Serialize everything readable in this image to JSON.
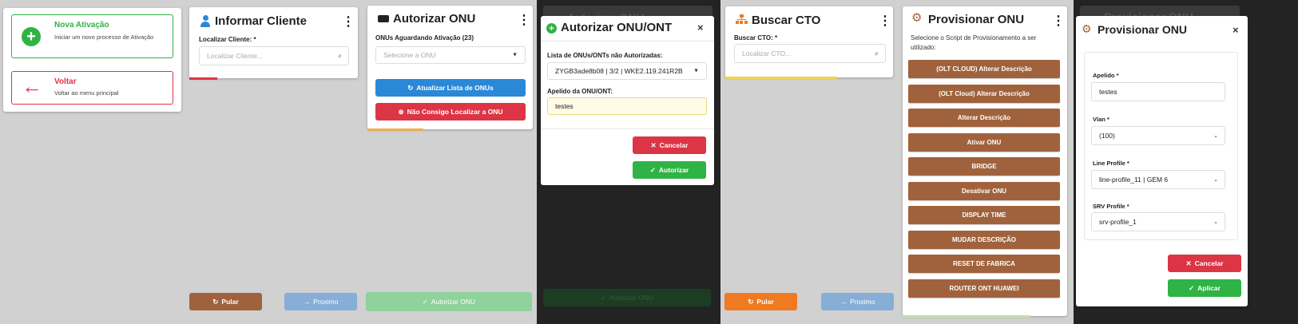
{
  "colors": {
    "green": "#2fb344",
    "red": "#dc3545",
    "brown": "#a0623c",
    "blue": "#2b88d8",
    "orange": "#ef7a22"
  },
  "panel1": {
    "nova_title": "Nova Ativação",
    "nova_desc": "Iniciar um novo processo de Ativação",
    "voltar_title": "Voltar",
    "voltar_desc": "Voltar ao menu principal"
  },
  "panel2": {
    "title": "Informar Cliente",
    "label": "Localizar Cliente: *",
    "placeholder": "Localizar Cliente...",
    "pular": "Pular",
    "proximo": "Proximo"
  },
  "panel3": {
    "title": "Autorizar ONU",
    "label": "ONUs Aguardando Ativação (23)",
    "select_placeholder": "Selecione a ONU",
    "atualizar": "Atualizar Lista de ONUs",
    "nao_consigo": "Não Consigo Localizar a ONU",
    "autorizar_bottom": "Autorizar ONU"
  },
  "panel4": {
    "bg_title": "Autorizar ONU",
    "modal_title": "Autorizar ONU/ONT",
    "list_label": "Lista de ONUs/ONTs não Autorizadas:",
    "list_value": "ZYGB3ade8b08 | 3/2 | WKE2.119.241R2B",
    "apelido_label": "Apelido da ONU/ONT:",
    "apelido_value": "testes",
    "cancelar": "Cancelar",
    "autorizar": "Autorizar",
    "autorizar_bottom": "Autorizar ONU"
  },
  "panel5": {
    "title": "Buscar CTO",
    "label": "Buscar CTO: *",
    "placeholder": "Localizar CTO...",
    "pular": "Pular",
    "proximo": "Proximo"
  },
  "panel6": {
    "title": "Provisionar ONU",
    "desc": "Selecione o Script de Provisionamento a ser utilizado:",
    "scripts": [
      "(OLT CLOUD) Alterar Descrição",
      "(OLT Cloud) Alterar Descrição",
      "Alterar Descrição",
      "Ativar ONU",
      "BRIDGE",
      "Desativar ONU",
      "DISPLAY TIME",
      "MUDAR DESCRIÇÃO",
      "RESET DE FABRICA",
      "ROUTER ONT HUAWEI"
    ]
  },
  "panel7": {
    "bg_title": "Provisionar ONU",
    "modal_title": "Provisionar ONU",
    "apelido_label": "Apelido *",
    "apelido_value": "testes",
    "vlan_label": "Vlan *",
    "vlan_value": "(100)",
    "line_label": "Line Profile *",
    "line_value": "line-profile_11 | GEM 6",
    "srv_label": "SRV Profile *",
    "srv_value": "srv-profile_1",
    "cancelar": "Cancelar",
    "aplicar": "Aplicar"
  }
}
